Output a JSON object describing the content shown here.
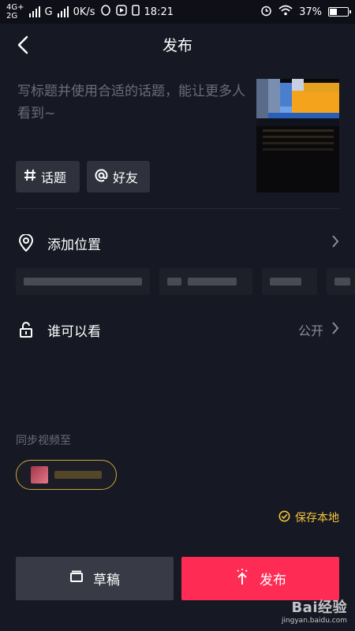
{
  "status_bar": {
    "net_top": "4G+",
    "net_bottom": "2G",
    "carrier2": "G",
    "speed": "0K/s",
    "time": "18:21",
    "battery_percent": "37%",
    "battery_level": 0.37,
    "icons": [
      "signal-icon",
      "qq-icon",
      "play-store-icon",
      "phone-icon",
      "alarm-icon",
      "wifi-icon",
      "battery-icon"
    ]
  },
  "nav": {
    "title": "发布",
    "back_icon": "chevron-left-icon"
  },
  "caption": {
    "placeholder": "写标题并使用合适的话题，能让更多人看到~"
  },
  "tags": [
    {
      "icon": "hash-icon",
      "label": "话题"
    },
    {
      "icon": "at-icon",
      "label": "好友"
    }
  ],
  "location": {
    "label": "添加位置",
    "icon": "location-pin-icon"
  },
  "visibility": {
    "label": "谁可以看",
    "value": "公开",
    "icon": "unlock-icon"
  },
  "sync": {
    "label": "同步视频至"
  },
  "save_local": {
    "label": "保存本地",
    "icon": "check-circle-icon"
  },
  "buttons": {
    "draft": "草稿",
    "publish": "发布"
  },
  "colors": {
    "background": "#161823",
    "publish": "#fe2c55",
    "accent_yellow": "#f5c63a"
  },
  "watermark": {
    "main": "Bai经验",
    "sub": "jingyan.baidu.com"
  }
}
